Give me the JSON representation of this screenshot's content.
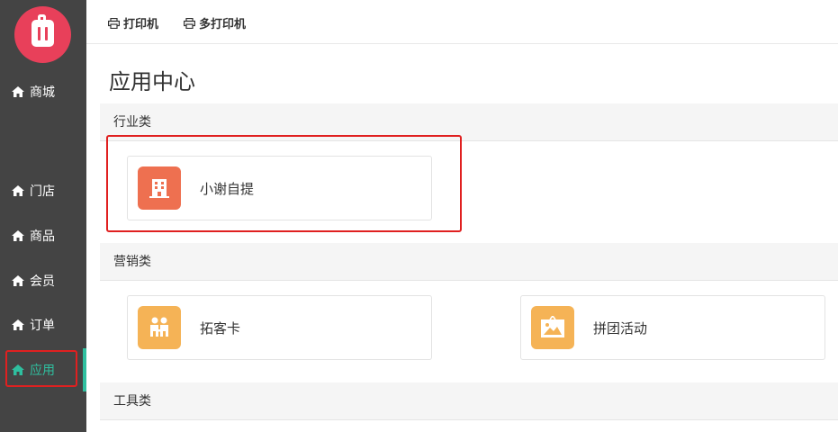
{
  "sidebar": {
    "items": [
      {
        "label": "商城",
        "icon": "home-icon"
      },
      {
        "label": "门店",
        "icon": "home-icon"
      },
      {
        "label": "商品",
        "icon": "home-icon"
      },
      {
        "label": "会员",
        "icon": "home-icon"
      },
      {
        "label": "订单",
        "icon": "home-icon"
      },
      {
        "label": "应用",
        "icon": "home-icon",
        "active": true
      }
    ],
    "active_color": "#2fbf9f",
    "background": "#444444"
  },
  "toolbar": {
    "printer_label": "打印机",
    "multi_printer_label": "多打印机"
  },
  "main": {
    "title": "应用中心",
    "sections": [
      {
        "title": "行业类",
        "apps": [
          {
            "label": "小谢自提",
            "icon": "building-icon",
            "color": "#ee7050"
          }
        ]
      },
      {
        "title": "营销类",
        "apps": [
          {
            "label": "拓客卡",
            "icon": "people-icon",
            "color": "#f5b356"
          },
          {
            "label": "拼团活动",
            "icon": "picture-icon",
            "color": "#f5b356"
          }
        ]
      },
      {
        "title": "工具类",
        "apps": []
      }
    ]
  },
  "highlight_color": "#e02020"
}
